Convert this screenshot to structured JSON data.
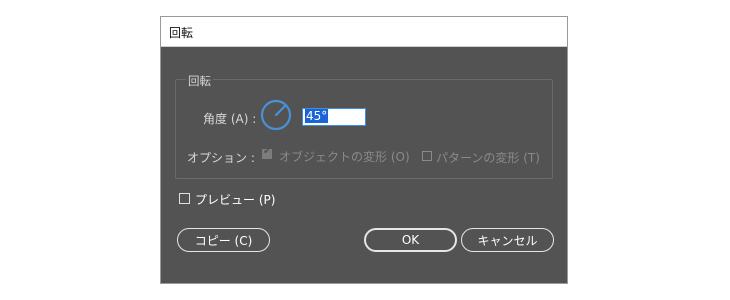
{
  "window": {
    "title": "回転"
  },
  "group": {
    "label": "回転"
  },
  "angle": {
    "label": "角度 (A) :",
    "value": "45°"
  },
  "options": {
    "label": "オプション :",
    "objects": {
      "label": "オブジェクトの変形 (O)",
      "checked": true,
      "enabled": false
    },
    "pattern": {
      "label": "パターンの変形 (T)",
      "checked": false,
      "enabled": false
    }
  },
  "preview": {
    "label": "プレビュー (P)",
    "checked": false
  },
  "buttons": {
    "copy": "コピー (C)",
    "ok": "OK",
    "cancel": "キャンセル"
  },
  "colors": {
    "dialog_bg": "#535353",
    "dial": "#4a90d9",
    "selection": "#1c63d6"
  }
}
